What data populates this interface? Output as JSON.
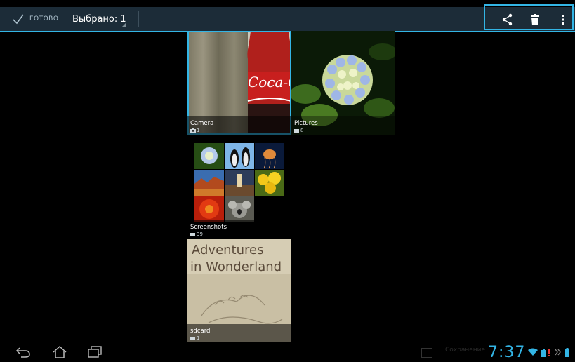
{
  "actionbar": {
    "done_label": "ГОТОВО",
    "selected_label": "Выбрано: 1",
    "accent": "#33b5e5",
    "icons": [
      "checkmark-icon",
      "share-icon",
      "trash-icon",
      "overflow-menu-icon"
    ]
  },
  "albums": [
    {
      "title": "Camera",
      "count": "1",
      "icon": "camera-icon",
      "selected": true
    },
    {
      "title": "Pictures",
      "count": "8",
      "icon": "folder-icon",
      "selected": false
    },
    {
      "title": "Screenshots",
      "count": "39",
      "icon": "folder-icon",
      "selected": false
    },
    {
      "title": "sdcard",
      "count": "1",
      "icon": "folder-icon",
      "selected": false
    }
  ],
  "camera_thumb_text": "Coca-Cola",
  "sdcard_thumb_text": {
    "line1": "Adventures",
    "line2": "in Wonderland"
  },
  "navbar": {
    "icons": [
      "back-icon",
      "home-icon",
      "recent-apps-icon"
    ]
  },
  "statusbar": {
    "notification_text": "Сохранение",
    "clock": "7:37",
    "icons": [
      "wifi-icon",
      "battery-warning-icon",
      "chevrons-icon",
      "battery-icon"
    ]
  }
}
